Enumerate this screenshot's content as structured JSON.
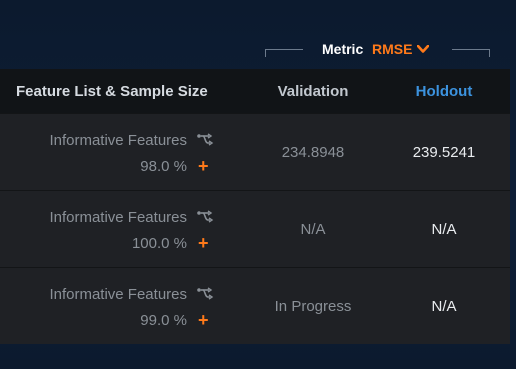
{
  "metric": {
    "label": "Metric",
    "value": "RMSE"
  },
  "table": {
    "headers": {
      "feature": "Feature List & Sample Size",
      "validation": "Validation",
      "holdout": "Holdout"
    },
    "rows": [
      {
        "feature_list": "Informative Features",
        "sample_size": "98.0 %",
        "validation": "234.8948",
        "holdout": "239.5241"
      },
      {
        "feature_list": "Informative Features",
        "sample_size": "100.0 %",
        "validation": "N/A",
        "holdout": "N/A"
      },
      {
        "feature_list": "Informative Features",
        "sample_size": "99.0 %",
        "validation": "In Progress",
        "holdout": "N/A"
      }
    ]
  },
  "icons": {
    "feature_list_icon": "branch-icon",
    "add_icon": "plus-icon",
    "dropdown_icon": "chevron-down-icon"
  },
  "colors": {
    "accent": "#ff7a1a",
    "holdout_header": "#3c93df"
  }
}
